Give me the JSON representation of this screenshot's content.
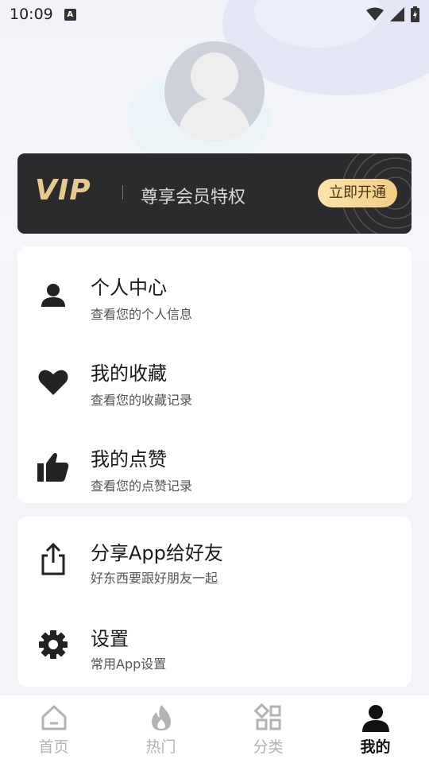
{
  "status_bar": {
    "time": "10:09",
    "notification_icon_text": "A"
  },
  "vip": {
    "logo": "VIP",
    "text": "尊享会员特权",
    "button": "立即开通"
  },
  "menu_group_1": [
    {
      "title": "个人中心",
      "subtitle": "查看您的个人信息",
      "icon": "person-icon"
    },
    {
      "title": "我的收藏",
      "subtitle": "查看您的收藏记录",
      "icon": "heart-icon"
    },
    {
      "title": "我的点赞",
      "subtitle": "查看您的点赞记录",
      "icon": "thumbs-up-icon"
    }
  ],
  "menu_group_2": [
    {
      "title": "分享App给好友",
      "subtitle": "好东西要跟好朋友一起",
      "icon": "share-icon"
    },
    {
      "title": "设置",
      "subtitle": "常用App设置",
      "icon": "gear-icon"
    }
  ],
  "tabs": [
    {
      "label": "首页",
      "icon": "home-icon",
      "active": false
    },
    {
      "label": "热门",
      "icon": "flame-icon",
      "active": false
    },
    {
      "label": "分类",
      "icon": "category-icon",
      "active": false
    },
    {
      "label": "我的",
      "icon": "profile-icon",
      "active": true
    }
  ],
  "colors": {
    "vip_gold": "#e6c98f",
    "active_tab": "#111111",
    "inactive_tab": "#b3b3b3"
  }
}
